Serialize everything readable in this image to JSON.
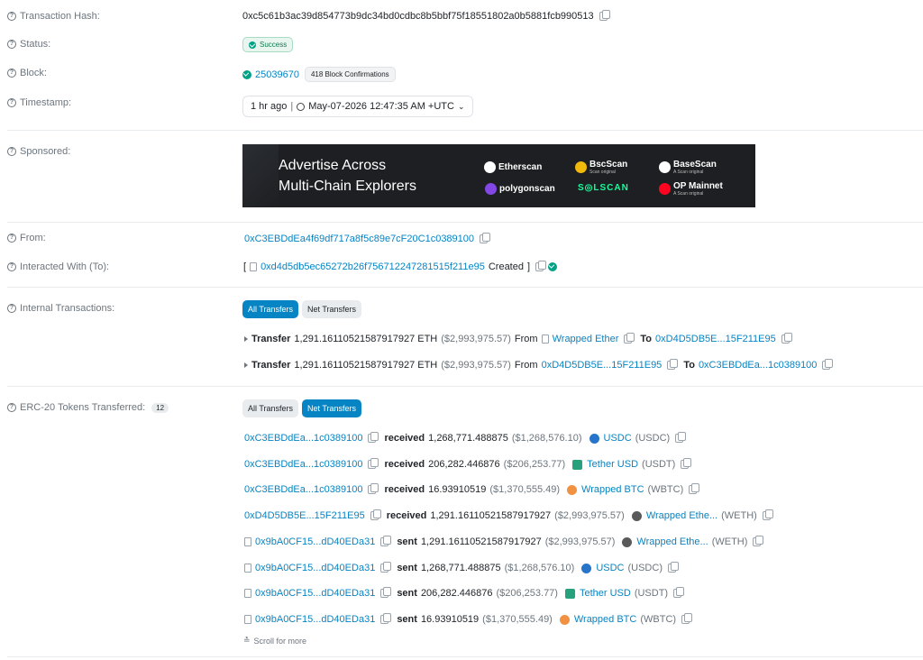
{
  "hash": {
    "label": "Transaction Hash:",
    "value": "0xc5c61b3ac39d854773b9dc34bd0cdbc8b5bbf75f18551802a0b5881fcb990513"
  },
  "status": {
    "label": "Status:",
    "value": "Success"
  },
  "block": {
    "label": "Block:",
    "number": "25039670",
    "confirmations": "418 Block Confirmations"
  },
  "timestamp": {
    "label": "Timestamp:",
    "ago": "1 hr ago",
    "sep": "|",
    "datetime": "May-07-2026 12:47:35 AM +UTC"
  },
  "sponsored": {
    "label": "Sponsored:",
    "title_line1": "Advertise Across",
    "title_line2": "Multi-Chain Explorers",
    "logos": {
      "etherscan": "Etherscan",
      "bscscan": "BscScan",
      "basescan": "BaseScan",
      "polygonscan": "polygonscan",
      "solscan": "S◎LSCAN",
      "opmainnet": "OP Mainnet",
      "bsc_sub": "Scan original",
      "base_sub": "A Scan original",
      "op_sub": "A Scan original"
    }
  },
  "from": {
    "label": "From:",
    "address": "0xC3EBDdEa4f69df717a8f5c89e7cF20C1c0389100"
  },
  "to": {
    "label": "Interacted With (To):",
    "open": "[",
    "address": "0xd4d5db5ec65272b26f756712247281515f211e95",
    "created": "Created",
    "close": "]"
  },
  "internal": {
    "label": "Internal Transactions:",
    "tab_all": "All Transfers",
    "tab_net": "Net Transfers",
    "rows": [
      {
        "prefix": "Transfer",
        "amount": "1,291.16110521587917927 ETH",
        "usd": "($2,993,975.57)",
        "from_word": "From",
        "from": "Wrapped Ether",
        "to_word": "To",
        "to": "0xD4D5DB5E...15F211E95"
      },
      {
        "prefix": "Transfer",
        "amount": "1,291.16110521587917927 ETH",
        "usd": "($2,993,975.57)",
        "from_word": "From",
        "from": "0xD4D5DB5E...15F211E95",
        "to_word": "To",
        "to": "0xC3EBDdEa...1c0389100"
      }
    ]
  },
  "erc20": {
    "label": "ERC-20 Tokens Transferred:",
    "count": "12",
    "tab_all": "All Transfers",
    "tab_net": "Net Transfers",
    "rows": [
      {
        "addr": "0xC3EBDdEa...1c0389100",
        "verb": "received",
        "amount": "1,268,771.488875",
        "usd": "($1,268,576.10)",
        "token": "USDC",
        "symbol": "(USDC)"
      },
      {
        "addr": "0xC3EBDdEa...1c0389100",
        "verb": "received",
        "amount": "206,282.446876",
        "usd": "($206,253.77)",
        "token": "Tether USD",
        "symbol": "(USDT)"
      },
      {
        "addr": "0xC3EBDdEa...1c0389100",
        "verb": "received",
        "amount": "16.93910519",
        "usd": "($1,370,555.49)",
        "token": "Wrapped BTC",
        "symbol": "(WBTC)"
      },
      {
        "addr": "0xD4D5DB5E...15F211E95",
        "verb": "received",
        "amount": "1,291.16110521587917927",
        "usd": "($2,993,975.57)",
        "token": "Wrapped Ethe...",
        "symbol": "(WETH)"
      },
      {
        "addr": "0x9bA0CF15...dD40EDa31",
        "verb": "sent",
        "amount": "1,291.16110521587917927",
        "usd": "($2,993,975.57)",
        "token": "Wrapped Ethe...",
        "symbol": "(WETH)"
      },
      {
        "addr": "0x9bA0CF15...dD40EDa31",
        "verb": "sent",
        "amount": "1,268,771.488875",
        "usd": "($1,268,576.10)",
        "token": "USDC",
        "symbol": "(USDC)"
      },
      {
        "addr": "0x9bA0CF15...dD40EDa31",
        "verb": "sent",
        "amount": "206,282.446876",
        "usd": "($206,253.77)",
        "token": "Tether USD",
        "symbol": "(USDT)"
      },
      {
        "addr": "0x9bA0CF15...dD40EDa31",
        "verb": "sent",
        "amount": "16.93910519",
        "usd": "($1,370,555.49)",
        "token": "Wrapped BTC",
        "symbol": "(WBTC)"
      }
    ],
    "scroll": "Scroll for more"
  },
  "colors": {
    "link": "#0784c3",
    "success": "#00a186",
    "usdc": "#2775ca",
    "usdt": "#26a17b",
    "wbtc": "#f09242",
    "weth": "#5a5a5a"
  }
}
